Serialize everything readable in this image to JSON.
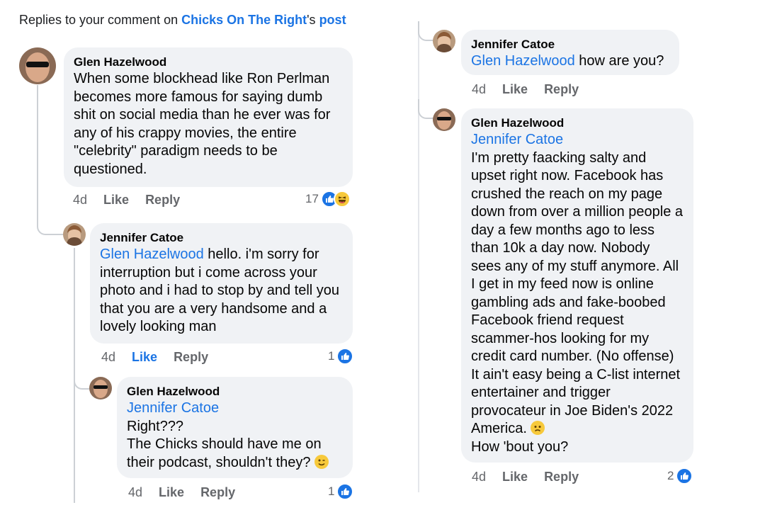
{
  "header": {
    "prefix": "Replies to your comment on ",
    "page_name": "Chicks On The Right",
    "possessive": "'s ",
    "post": "post"
  },
  "comments": [
    {
      "author": "Glen Hazelwood",
      "text": "When some blockhead like Ron Perlman becomes more famous for saying dumb shit on social media than he ever was for any of his crappy movies, the entire \"celebrity\" paradigm needs to be questioned.",
      "time": "4d",
      "like": "Like",
      "reply": "Reply",
      "reactions": "17"
    },
    {
      "author": "Jennifer Catoe",
      "mention": "Glen Hazelwood",
      "text": " hello. i'm sorry for interruption   but i come across your photo and i had to stop by and tell you that  you are a very handsome and a lovely looking man",
      "time": "4d",
      "like": "Like",
      "reply": "Reply",
      "reactions": "1"
    },
    {
      "author": "Glen Hazelwood",
      "mention": "Jennifer Catoe",
      "line1": "Right???",
      "line2": "The Chicks should have me on their podcast, shouldn't they?",
      "time": "4d",
      "like": "Like",
      "reply": "Reply",
      "reactions": "1"
    },
    {
      "author": "Jennifer Catoe",
      "mention": "Glen Hazelwood",
      "text": " how are you?",
      "time": "4d",
      "like": "Like",
      "reply": "Reply"
    },
    {
      "author": "Glen Hazelwood",
      "mention": "Jennifer Catoe",
      "text": "I'm pretty faacking salty and upset right now. Facebook has crushed the reach on my page down from over a million people a day a few months ago to less than 10k a day now. Nobody sees any of my stuff anymore. All I get in my feed now is online gambling ads and fake-boobed Facebook friend request scammer-hos looking for my credit card number. (No offense) It ain't easy being a C-list internet entertainer and trigger provocateur in Joe Biden's 2022 America.",
      "closing": "How 'bout you?",
      "time": "4d",
      "like": "Like",
      "reply": "Reply",
      "reactions": "2"
    }
  ],
  "colors": {
    "link": "#1b74e4",
    "bubble": "#f0f2f5",
    "muted": "#65676b",
    "thread": "#ccd0d5"
  },
  "icons": [
    "avatar-glen",
    "avatar-jennifer",
    "like-reaction-icon",
    "haha-reaction-icon",
    "wink-emoji",
    "worried-emoji"
  ]
}
